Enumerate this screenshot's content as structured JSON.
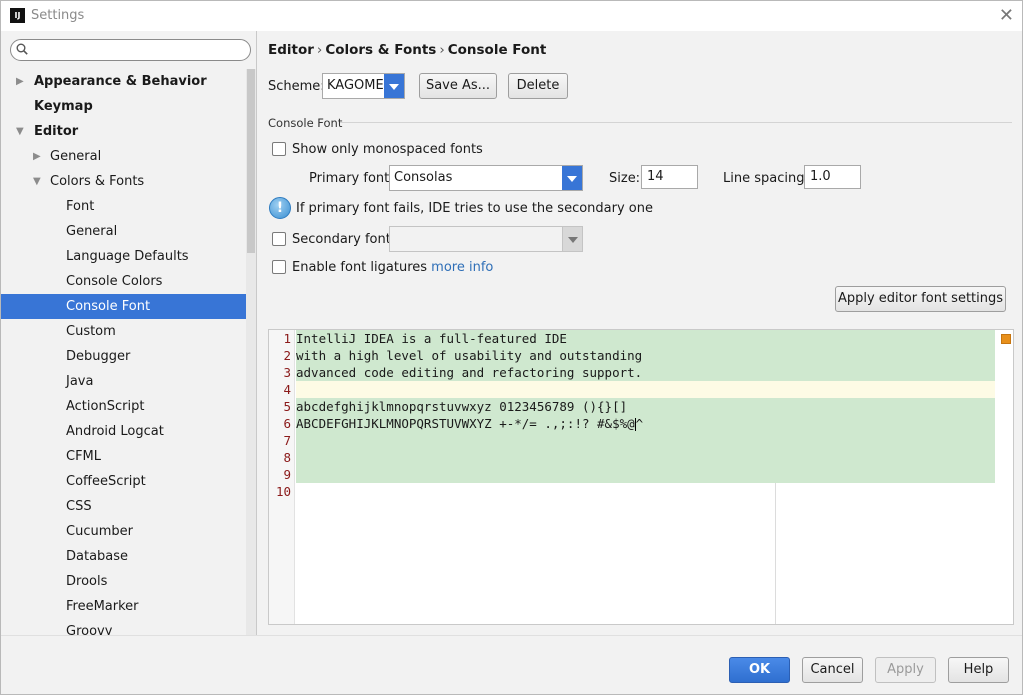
{
  "window": {
    "title": "Settings",
    "app_icon": "IJ"
  },
  "search": {
    "placeholder": "",
    "value": ""
  },
  "tree": [
    {
      "label": "Appearance & Behavior",
      "bold": true,
      "arrow": "right",
      "level": 0
    },
    {
      "label": "Keymap",
      "bold": true,
      "arrow": "",
      "level": 0
    },
    {
      "label": "Editor",
      "bold": true,
      "arrow": "down",
      "level": 0
    },
    {
      "label": "General",
      "bold": false,
      "arrow": "right",
      "level": 1
    },
    {
      "label": "Colors & Fonts",
      "bold": false,
      "arrow": "down",
      "level": 1
    },
    {
      "label": "Font",
      "bold": false,
      "arrow": "",
      "level": 2
    },
    {
      "label": "General",
      "bold": false,
      "arrow": "",
      "level": 2
    },
    {
      "label": "Language Defaults",
      "bold": false,
      "arrow": "",
      "level": 2
    },
    {
      "label": "Console Colors",
      "bold": false,
      "arrow": "",
      "level": 2
    },
    {
      "label": "Console Font",
      "bold": false,
      "arrow": "",
      "level": 2,
      "selected": true
    },
    {
      "label": "Custom",
      "bold": false,
      "arrow": "",
      "level": 2
    },
    {
      "label": "Debugger",
      "bold": false,
      "arrow": "",
      "level": 2
    },
    {
      "label": "Java",
      "bold": false,
      "arrow": "",
      "level": 2
    },
    {
      "label": "ActionScript",
      "bold": false,
      "arrow": "",
      "level": 2
    },
    {
      "label": "Android Logcat",
      "bold": false,
      "arrow": "",
      "level": 2
    },
    {
      "label": "CFML",
      "bold": false,
      "arrow": "",
      "level": 2
    },
    {
      "label": "CoffeeScript",
      "bold": false,
      "arrow": "",
      "level": 2
    },
    {
      "label": "CSS",
      "bold": false,
      "arrow": "",
      "level": 2
    },
    {
      "label": "Cucumber",
      "bold": false,
      "arrow": "",
      "level": 2
    },
    {
      "label": "Database",
      "bold": false,
      "arrow": "",
      "level": 2
    },
    {
      "label": "Drools",
      "bold": false,
      "arrow": "",
      "level": 2
    },
    {
      "label": "FreeMarker",
      "bold": false,
      "arrow": "",
      "level": 2
    },
    {
      "label": "Groovy",
      "bold": false,
      "arrow": "",
      "level": 2
    }
  ],
  "breadcrumb": [
    "Editor",
    "Colors & Fonts",
    "Console Font"
  ],
  "breadcrumb_sep": "›",
  "scheme": {
    "label": "Scheme:",
    "value": "KAGOME",
    "save_as": "Save As...",
    "delete": "Delete"
  },
  "console_font": {
    "section_title": "Console Font",
    "monospaced_label": "Show only monospaced fonts",
    "monospaced_checked": false,
    "primary_label": "Primary font:",
    "primary_value": "Consolas",
    "size_label": "Size:",
    "size_value": "14",
    "spacing_label": "Line spacing:",
    "spacing_value": "1.0",
    "info_text": "If primary font fails, IDE tries to use the secondary one",
    "secondary_label": "Secondary font:",
    "secondary_value": "",
    "secondary_checked": false,
    "ligatures_label": "Enable font ligatures",
    "ligatures_link": "more info",
    "ligatures_checked": false,
    "apply_editor": "Apply editor font settings"
  },
  "preview": {
    "line_numbers": [
      "1",
      "2",
      "3",
      "4",
      "5",
      "6",
      "7",
      "8",
      "9",
      "10"
    ],
    "lines": [
      "IntelliJ IDEA is a full-featured IDE",
      "with a high level of usability and outstanding",
      "advanced code editing and refactoring support.",
      "",
      "abcdefghijklmnopqrstuvwxyz 0123456789 (){}[]",
      "ABCDEFGHIJKLMNOPQRSTUVWXYZ +-*/= .,;:!? #&$%@",
      "",
      "",
      "",
      ""
    ],
    "line6_tail": "^",
    "colors": {
      "highlight": "#cfe8cf",
      "current_line": "#fdfbe5",
      "line_number": "#8b1a1a"
    }
  },
  "footer": {
    "ok": "OK",
    "cancel": "Cancel",
    "apply": "Apply",
    "help": "Help"
  },
  "colors": {
    "accent": "#3875d6",
    "marker": "#e8901b"
  }
}
